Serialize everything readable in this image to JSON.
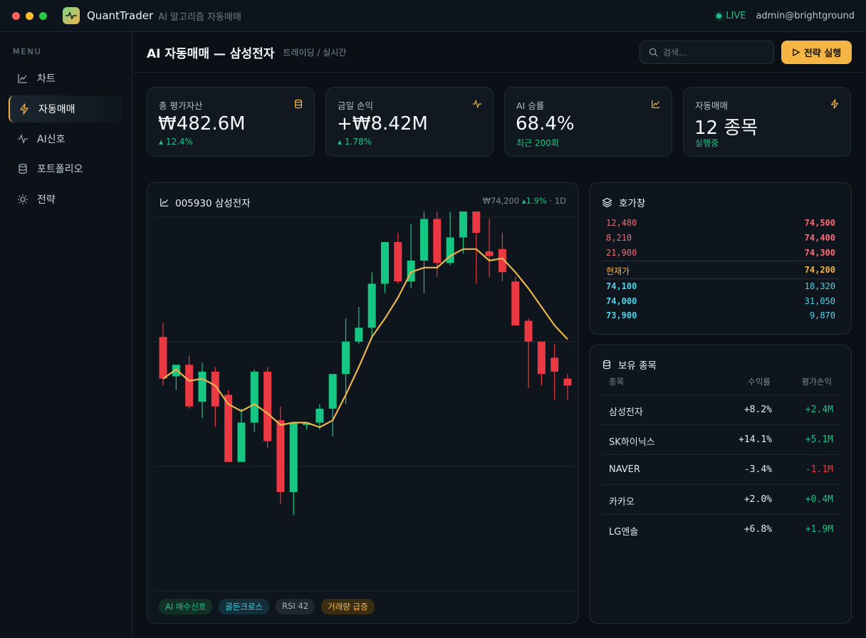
{
  "window": {
    "app_name": "QuantTrader",
    "app_subtitle": "AI 알고리즘 자동매매",
    "live_label": "LIVE",
    "user": "admin@brightground"
  },
  "sidebar": {
    "menu_label": "MENU",
    "items": [
      {
        "label": "차트",
        "icon": "chart-line-icon"
      },
      {
        "label": "자동매매",
        "icon": "lightning-icon",
        "active": true
      },
      {
        "label": "AI신호",
        "icon": "pulse-icon"
      },
      {
        "label": "포트폴리오",
        "icon": "database-icon"
      },
      {
        "label": "전략",
        "icon": "sun-gear-icon"
      }
    ]
  },
  "header": {
    "title": "AI 자동매매 — 삼성전자",
    "breadcrumb": "트레이딩 / 실시간",
    "search_placeholder": "검색...",
    "run_button": "전략 실행"
  },
  "stats": [
    {
      "label": "총 평가자산",
      "value": "₩482.6M",
      "sub": "▴ 12.4%",
      "icon": "database-icon"
    },
    {
      "label": "금일 손익",
      "value": "+₩8.42M",
      "sub": "▴ 1.78%",
      "icon": "pulse-icon"
    },
    {
      "label": "AI 승률",
      "value": "68.4%",
      "sub": "최근 200회",
      "icon": "chart-line-icon"
    },
    {
      "label": "자동매매",
      "value": "12 종목",
      "sub": "실행중",
      "icon": "lightning-icon"
    }
  ],
  "chart": {
    "title": "005930 삼성전자",
    "price": "₩74,200",
    "change": "▴1.9%",
    "interval": "· 1D",
    "tags": [
      {
        "label": "AI 매수신호",
        "color": "#22c08a",
        "bg": "#123026"
      },
      {
        "label": "골든크로스",
        "color": "#4fd3e8",
        "bg": "#12303a"
      },
      {
        "label": "RSI 42",
        "color": "#aab4bf",
        "bg": "#1f2731"
      },
      {
        "label": "거래량 급증",
        "color": "#f5b544",
        "bg": "#3a2d12"
      }
    ]
  },
  "chart_data": {
    "type": "candlestick",
    "title": "005930 삼성전자",
    "up_color": "#16c784",
    "down_color": "#ea3943",
    "ma_color": "#e9b44c",
    "ylim": [
      0,
      100
    ],
    "candles": [
      {
        "o": 55,
        "h": 61,
        "l": 34,
        "c": 37
      },
      {
        "o": 38,
        "h": 42,
        "l": 32,
        "c": 43
      },
      {
        "o": 43,
        "h": 47,
        "l": 24,
        "c": 25
      },
      {
        "o": 27,
        "h": 44,
        "l": 20,
        "c": 40
      },
      {
        "o": 40,
        "h": 42,
        "l": 16,
        "c": 25
      },
      {
        "o": 30,
        "h": 32,
        "l": 1,
        "c": 1
      },
      {
        "o": 1,
        "h": 24,
        "l": 8,
        "c": 18
      },
      {
        "o": 18,
        "h": 41,
        "l": 14,
        "c": 40
      },
      {
        "o": 40,
        "h": 42,
        "l": 7,
        "c": 10
      },
      {
        "o": 19,
        "h": 25,
        "l": -17,
        "c": -12
      },
      {
        "o": -12,
        "h": 17,
        "l": -22,
        "c": 18
      },
      {
        "o": 17,
        "h": 18,
        "l": 15,
        "c": 18
      },
      {
        "o": 18,
        "h": 26,
        "l": 15,
        "c": 24
      },
      {
        "o": 24,
        "h": 37,
        "l": 12,
        "c": 39
      },
      {
        "o": 39,
        "h": 63,
        "l": 26,
        "c": 53
      },
      {
        "o": 53,
        "h": 68,
        "l": 52,
        "c": 59
      },
      {
        "o": 59,
        "h": 83,
        "l": 54,
        "c": 78
      },
      {
        "o": 78,
        "h": 93,
        "l": 74,
        "c": 96
      },
      {
        "o": 96,
        "h": 100,
        "l": 78,
        "c": 79
      },
      {
        "o": 79,
        "h": 104,
        "l": 76,
        "c": 88
      },
      {
        "o": 88,
        "h": 110,
        "l": 74,
        "c": 106
      },
      {
        "o": 106,
        "h": 118,
        "l": 81,
        "c": 87
      },
      {
        "o": 87,
        "h": 111,
        "l": 86,
        "c": 98
      },
      {
        "o": 98,
        "h": 115,
        "l": 91,
        "c": 111
      },
      {
        "o": 111,
        "h": 115,
        "l": 78,
        "c": 100
      },
      {
        "o": 92,
        "h": 106,
        "l": 81,
        "c": 90
      },
      {
        "o": 93,
        "h": 100,
        "l": 79,
        "c": 83
      },
      {
        "o": 79,
        "h": 81,
        "l": 68,
        "c": 60
      },
      {
        "o": 62,
        "h": 63,
        "l": 33,
        "c": 53
      },
      {
        "o": 53,
        "h": 53,
        "l": 34,
        "c": 39
      },
      {
        "o": 46,
        "h": 52,
        "l": 28,
        "c": 40
      },
      {
        "o": 37,
        "h": 39,
        "l": 28,
        "c": 34
      }
    ],
    "ma": [
      37,
      41,
      36,
      37,
      34,
      26,
      23,
      26,
      22,
      17,
      18,
      18,
      16,
      19,
      30,
      42,
      55,
      63,
      72,
      83,
      85,
      85,
      90,
      93,
      93,
      88,
      89,
      83,
      76,
      68,
      60,
      54
    ]
  },
  "orderbook": {
    "title": "호가창",
    "asks": [
      {
        "qty": "12,480",
        "price": "74,500"
      },
      {
        "qty": "8,210",
        "price": "74,400"
      },
      {
        "qty": "21,900",
        "price": "74,300"
      }
    ],
    "current_label": "현재가",
    "current_price": "74,200",
    "bids": [
      {
        "price": "74,100",
        "qty": "18,320"
      },
      {
        "price": "74,000",
        "qty": "31,050"
      },
      {
        "price": "73,900",
        "qty": "9,870"
      }
    ]
  },
  "holdings": {
    "title": "보유 종목",
    "headers": [
      "종목",
      "수익률",
      "평가손익"
    ],
    "rows": [
      {
        "name": "삼성전자",
        "ret": "+8.2%",
        "pnl": "+2.4M",
        "pnl_color": "#22c08a"
      },
      {
        "name": "SK하이닉스",
        "ret": "+14.1%",
        "pnl": "+5.1M",
        "pnl_color": "#22c08a"
      },
      {
        "name": "NAVER",
        "ret": "-3.4%",
        "pnl": "-1.1M",
        "pnl_color": "#ea3943"
      },
      {
        "name": "카카오",
        "ret": "+2.0%",
        "pnl": "+0.4M",
        "pnl_color": "#22c08a"
      },
      {
        "name": "LG엔솔",
        "ret": "+6.8%",
        "pnl": "+1.9M",
        "pnl_color": "#22c08a"
      }
    ]
  }
}
